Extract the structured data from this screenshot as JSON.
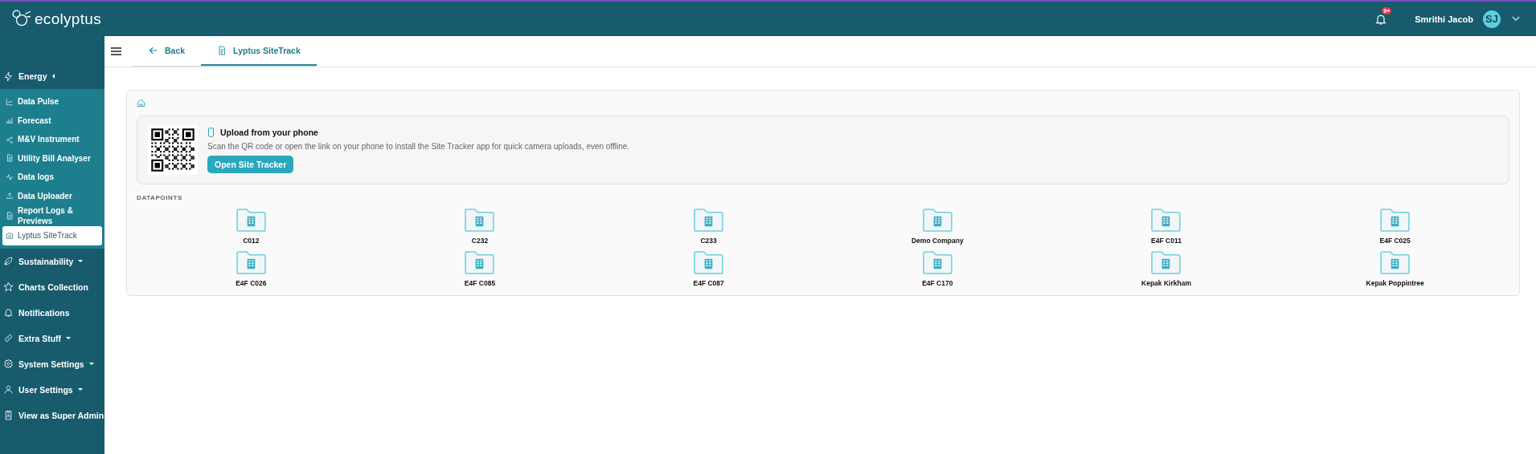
{
  "brand": {
    "name": "ecolyptus"
  },
  "header": {
    "notifications_badge": "9+",
    "user_name": "Smrithi Jacob",
    "avatar_initials": "SJ"
  },
  "sidebar": {
    "items": [
      {
        "label": "Energy",
        "expanded": true,
        "children": [
          {
            "label": "Data Pulse",
            "selected": false
          },
          {
            "label": "Forecast",
            "selected": false
          },
          {
            "label": "M&V Instrument",
            "selected": false
          },
          {
            "label": "Utility Bill Analyser",
            "selected": false
          },
          {
            "label": "Data logs",
            "selected": false
          },
          {
            "label": "Data Uploader",
            "selected": false
          },
          {
            "label": "Report Logs & Previews",
            "selected": false
          },
          {
            "label": "Lyptus SiteTrack",
            "selected": true
          }
        ]
      },
      {
        "label": "Sustainability",
        "expanded": false
      },
      {
        "label": "Charts Collection"
      },
      {
        "label": "Notifications"
      },
      {
        "label": "Extra Stuff",
        "expanded": false
      },
      {
        "label": "System Settings",
        "expanded": false
      },
      {
        "label": "User Settings",
        "expanded": false
      },
      {
        "label": "View as Super Admin"
      }
    ]
  },
  "tabs": [
    {
      "label": "Back",
      "selected": false
    },
    {
      "label": "Lyptus SiteTrack",
      "selected": true
    }
  ],
  "upload_card": {
    "title": "Upload from your phone",
    "description": "Scan the QR code or open the link on your phone to install the Site Tracker app for quick camera uploads, even offline.",
    "button": "Open Site Tracker"
  },
  "datapoints": {
    "heading": "DATAPOINTS",
    "items": [
      "C012",
      "C232",
      "C233",
      "Demo Company",
      "E4F C011",
      "E4F C025",
      "E4F C026",
      "E4F C085",
      "E4F C087",
      "E4F C170",
      "Kepak Kirkham",
      "Kepak Poppintree"
    ]
  }
}
